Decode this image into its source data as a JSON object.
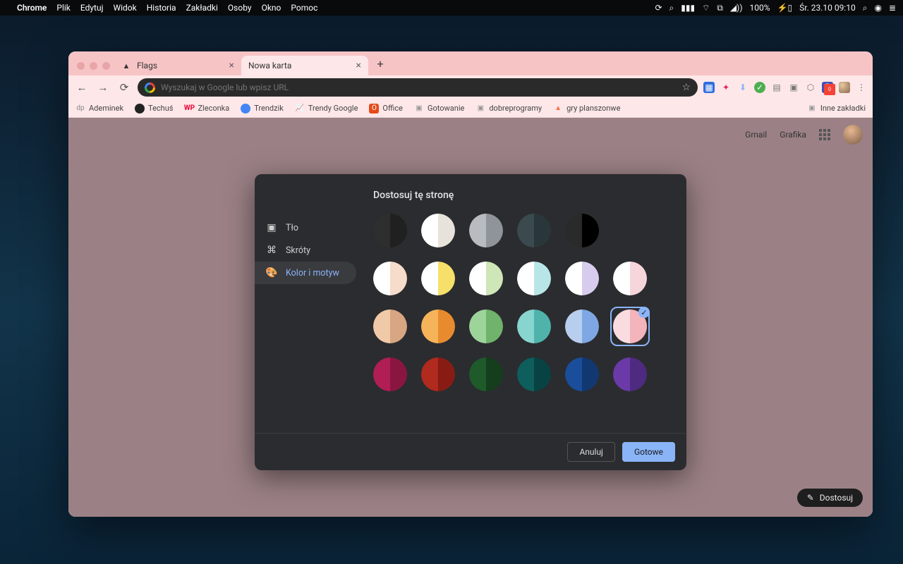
{
  "menubar": {
    "app": "Chrome",
    "items": [
      "Plik",
      "Edytuj",
      "Widok",
      "Historia",
      "Zakładki",
      "Osoby",
      "Okno",
      "Pomoc"
    ],
    "battery": "100%",
    "datetime": "Śr. 23.10  09:10"
  },
  "tabs": [
    {
      "title": "Flags",
      "active": false
    },
    {
      "title": "Nowa karta",
      "active": true
    }
  ],
  "omnibox": {
    "placeholder": "Wyszukaj w Google lub wpisz URL"
  },
  "bookmarks": [
    {
      "label": "Ademinek",
      "color": "#e8e8e8",
      "txt": "dp"
    },
    {
      "label": "Techuś",
      "color": "#222",
      "txt": "◉"
    },
    {
      "label": "Zleconka",
      "color": "#e03",
      "txt": "WP"
    },
    {
      "label": "Trendzik",
      "color": "#4285f4",
      "txt": "◉"
    },
    {
      "label": "Trendy Google",
      "color": "#fff",
      "txt": "📈"
    },
    {
      "label": "Office",
      "color": "#e64a19",
      "txt": "O"
    },
    {
      "label": "Gotowanie",
      "color": "#999",
      "txt": "▣"
    },
    {
      "label": "dobreprogramy",
      "color": "#999",
      "txt": "▣"
    },
    {
      "label": "gry planszonwe",
      "color": "#ff7043",
      "txt": "▲"
    }
  ],
  "bookmarks_other": "Inne zakładki",
  "topright": {
    "gmail": "Gmail",
    "grafika": "Grafika"
  },
  "customize_btn": "Dostosuj",
  "dialog": {
    "title": "Dostosuj tę stronę",
    "sidebar": {
      "bg": "Tło",
      "shortcuts": "Skróty",
      "theme": "Kolor i motyw"
    },
    "swatches": [
      {
        "l": "#2e2e2e",
        "r": "#202020"
      },
      {
        "l": "#ffffff",
        "r": "#e8e3da"
      },
      {
        "l": "#b8bcc0",
        "r": "#8e9499"
      },
      {
        "l": "#3a4a4e",
        "r": "#2a373a"
      },
      {
        "l": "#2a2a2a",
        "r": "#000000"
      },
      null,
      {
        "l": "#ffffff",
        "r": "#f6dccb"
      },
      {
        "l": "#ffffff",
        "r": "#f6e06a"
      },
      {
        "l": "#ffffff",
        "r": "#cfe6b8"
      },
      {
        "l": "#ffffff",
        "r": "#b8e6e6"
      },
      {
        "l": "#ffffff",
        "r": "#d8ccee"
      },
      {
        "l": "#ffffff",
        "r": "#f6d6db"
      },
      {
        "l": "#f0caa8",
        "r": "#d8a682"
      },
      {
        "l": "#f5b45a",
        "r": "#e88b2e"
      },
      {
        "l": "#9dd49a",
        "r": "#6fb36c"
      },
      {
        "l": "#88d4cf",
        "r": "#4fb3ac"
      },
      {
        "l": "#b8ceee",
        "r": "#7ea7e4"
      },
      {
        "l": "#fadce0",
        "r": "#f3b4bc",
        "selected": true
      },
      {
        "l": "#b01e55",
        "r": "#8a1640"
      },
      {
        "l": "#b02a1e",
        "r": "#881c14"
      },
      {
        "l": "#1e5a2a",
        "r": "#143e1c"
      },
      {
        "l": "#0e5e5e",
        "r": "#084242"
      },
      {
        "l": "#1a4e9a",
        "r": "#123872"
      },
      {
        "l": "#6a3aa8",
        "r": "#4e2a80"
      }
    ],
    "cancel": "Anuluj",
    "done": "Gotowe"
  }
}
